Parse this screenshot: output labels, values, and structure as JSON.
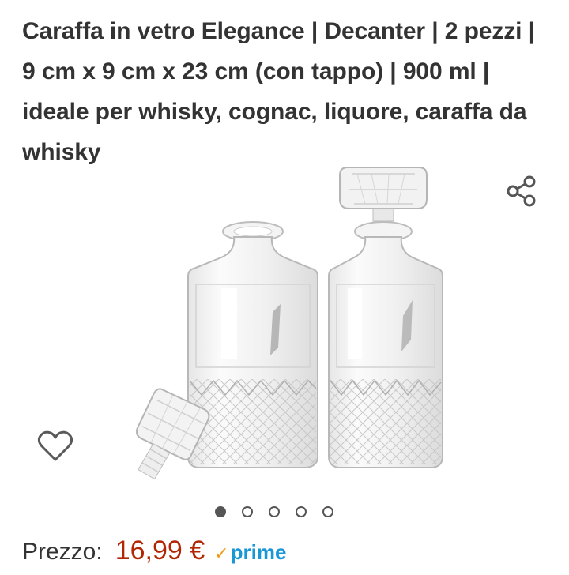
{
  "product": {
    "title": "Caraffa in vetro Elegance | Decanter | 2 pezzi | 9 cm x 9 cm x 23 cm (con tappo) | 900 ml | ideale per whisky, cognac, liquore, caraffa da whisky"
  },
  "gallery": {
    "image_alt": "Caraffa in vetro Elegance",
    "current_index": 1,
    "total_images": 5
  },
  "price": {
    "label": "Prezzo:",
    "value": "16,99 €",
    "badge": "prime"
  },
  "icons": {
    "share": "share-icon",
    "wishlist": "heart-icon",
    "prime_check": "checkmark-icon"
  },
  "colors": {
    "price": "#B12704",
    "prime_blue": "#1a98d5",
    "prime_check": "#f09b18",
    "text": "#333333"
  }
}
